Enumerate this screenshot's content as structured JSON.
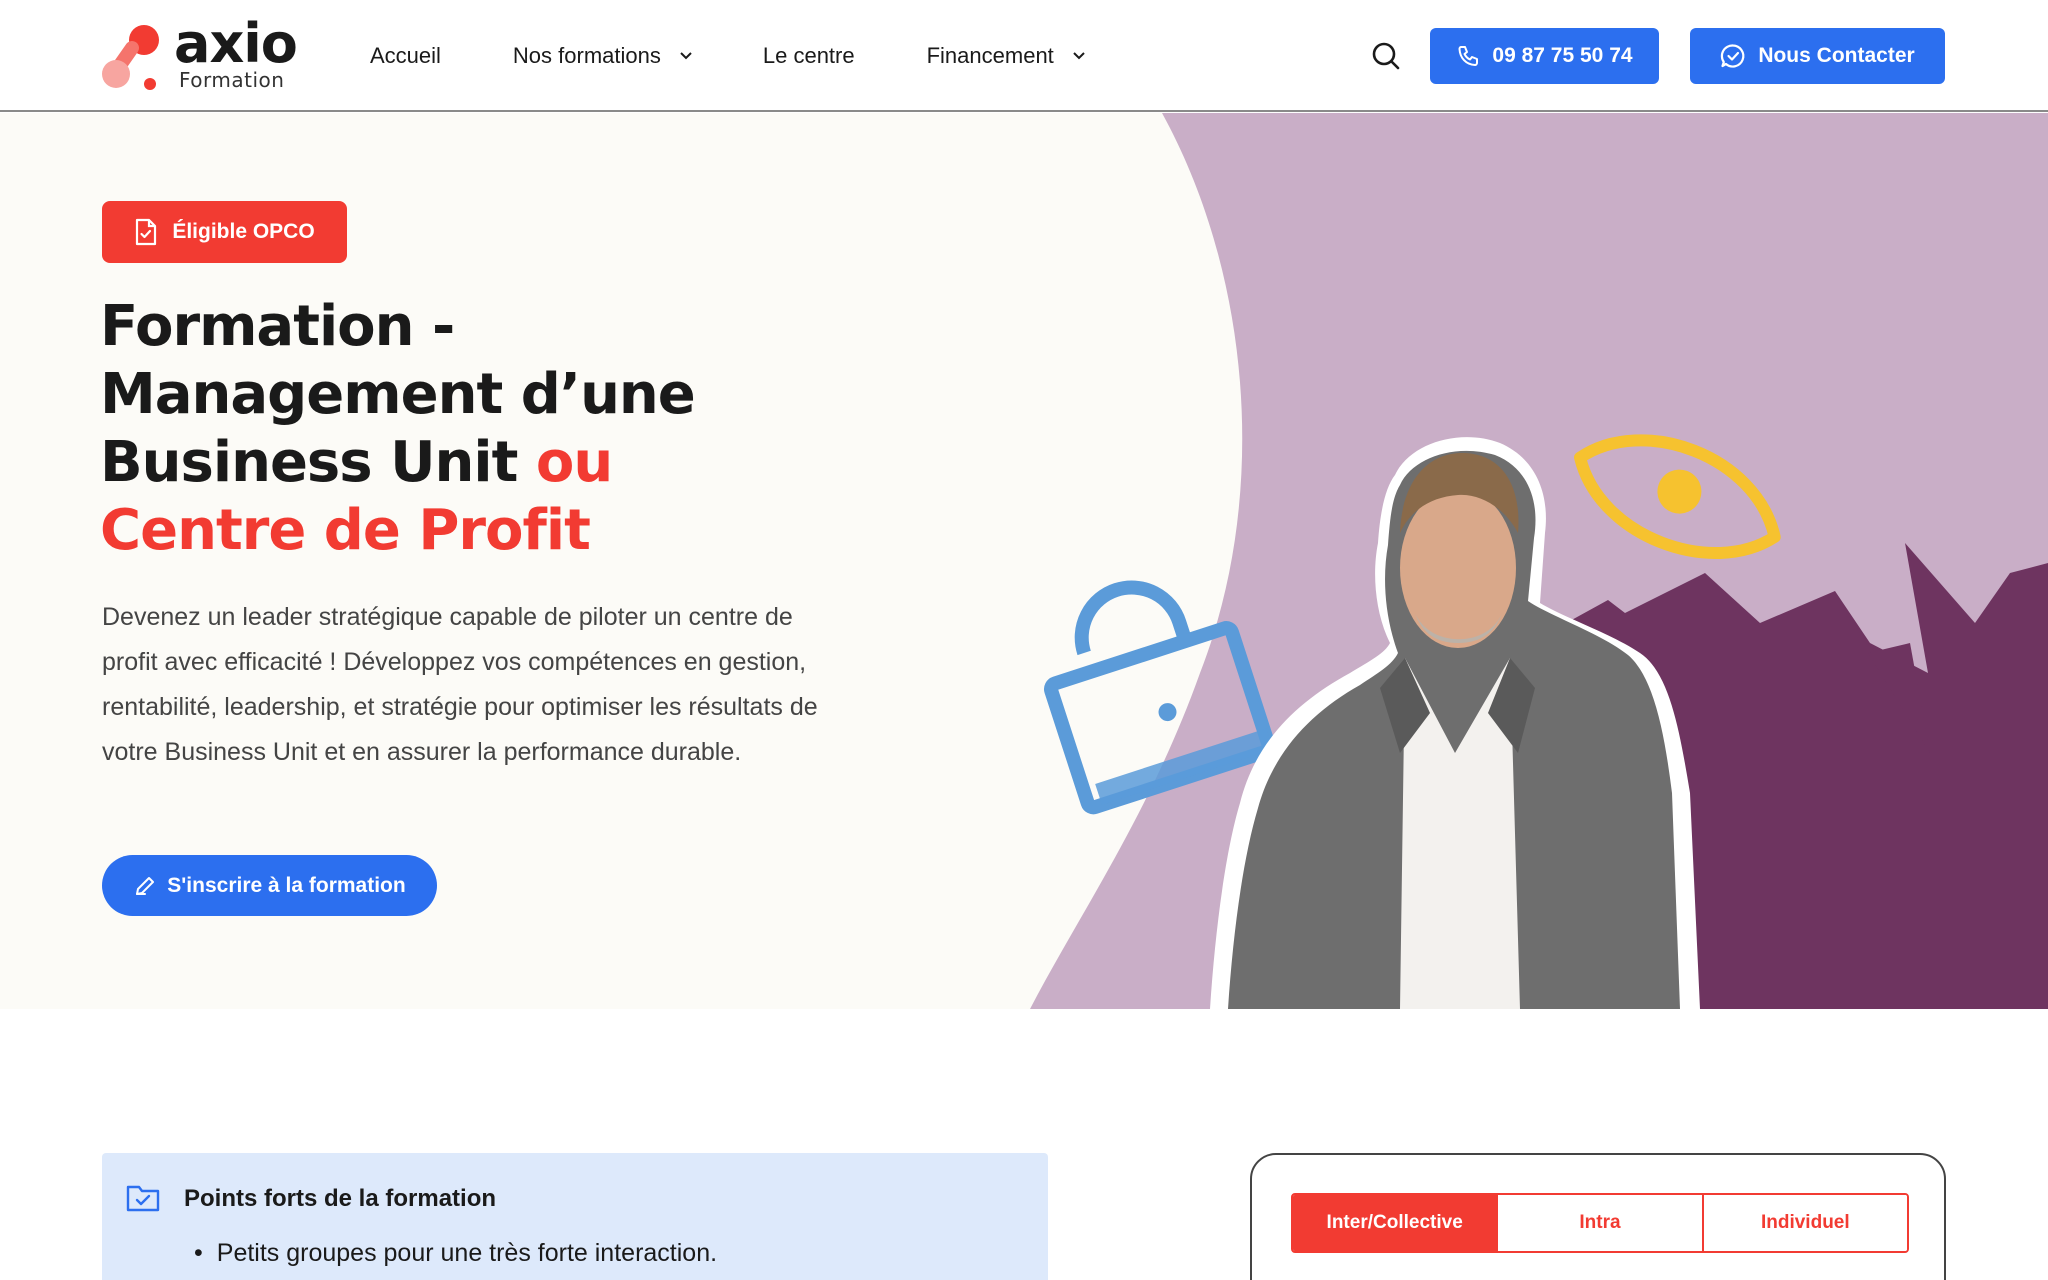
{
  "brand": {
    "name": "axio",
    "subtitle": "Formation",
    "colors": {
      "red": "#f23b32",
      "blue": "#2c6fef",
      "purple_light": "#c9aec7",
      "purple_dark": "#6e3460",
      "yellow": "#f6c22f",
      "lock_blue": "#5b9bd9"
    }
  },
  "nav": {
    "items": [
      {
        "label": "Accueil",
        "has_dropdown": false
      },
      {
        "label": "Nos formations",
        "has_dropdown": true
      },
      {
        "label": "Le centre",
        "has_dropdown": false
      },
      {
        "label": "Financement",
        "has_dropdown": true
      }
    ],
    "search_icon": "search-icon",
    "phone_label": "09 87 75 50 74",
    "contact_label": "Nous Contacter"
  },
  "hero": {
    "badge_label": "Éligible OPCO",
    "title_line1": "Formation -",
    "title_line2": "Management d’une",
    "title_line3_dark": "Business Unit ",
    "title_line3_accent": "ou",
    "title_line4_accent": "Centre de Profit",
    "description": "Devenez un leader stratégique capable de piloter un centre de profit avec efficacité ! Développez vos compétences en gestion, rentabilité, leadership, et stratégie pour optimiser les résultats de votre Business Unit et en assurer la performance durable.",
    "cta_label": "S'inscrire à la formation"
  },
  "points": {
    "title": "Points forts de la formation",
    "items": [
      "Petits groupes pour une très forte interaction."
    ]
  },
  "pricing": {
    "tabs": [
      {
        "label": "Inter/Collective",
        "active": true
      },
      {
        "label": "Intra",
        "active": false
      },
      {
        "label": "Individuel",
        "active": false
      }
    ]
  }
}
